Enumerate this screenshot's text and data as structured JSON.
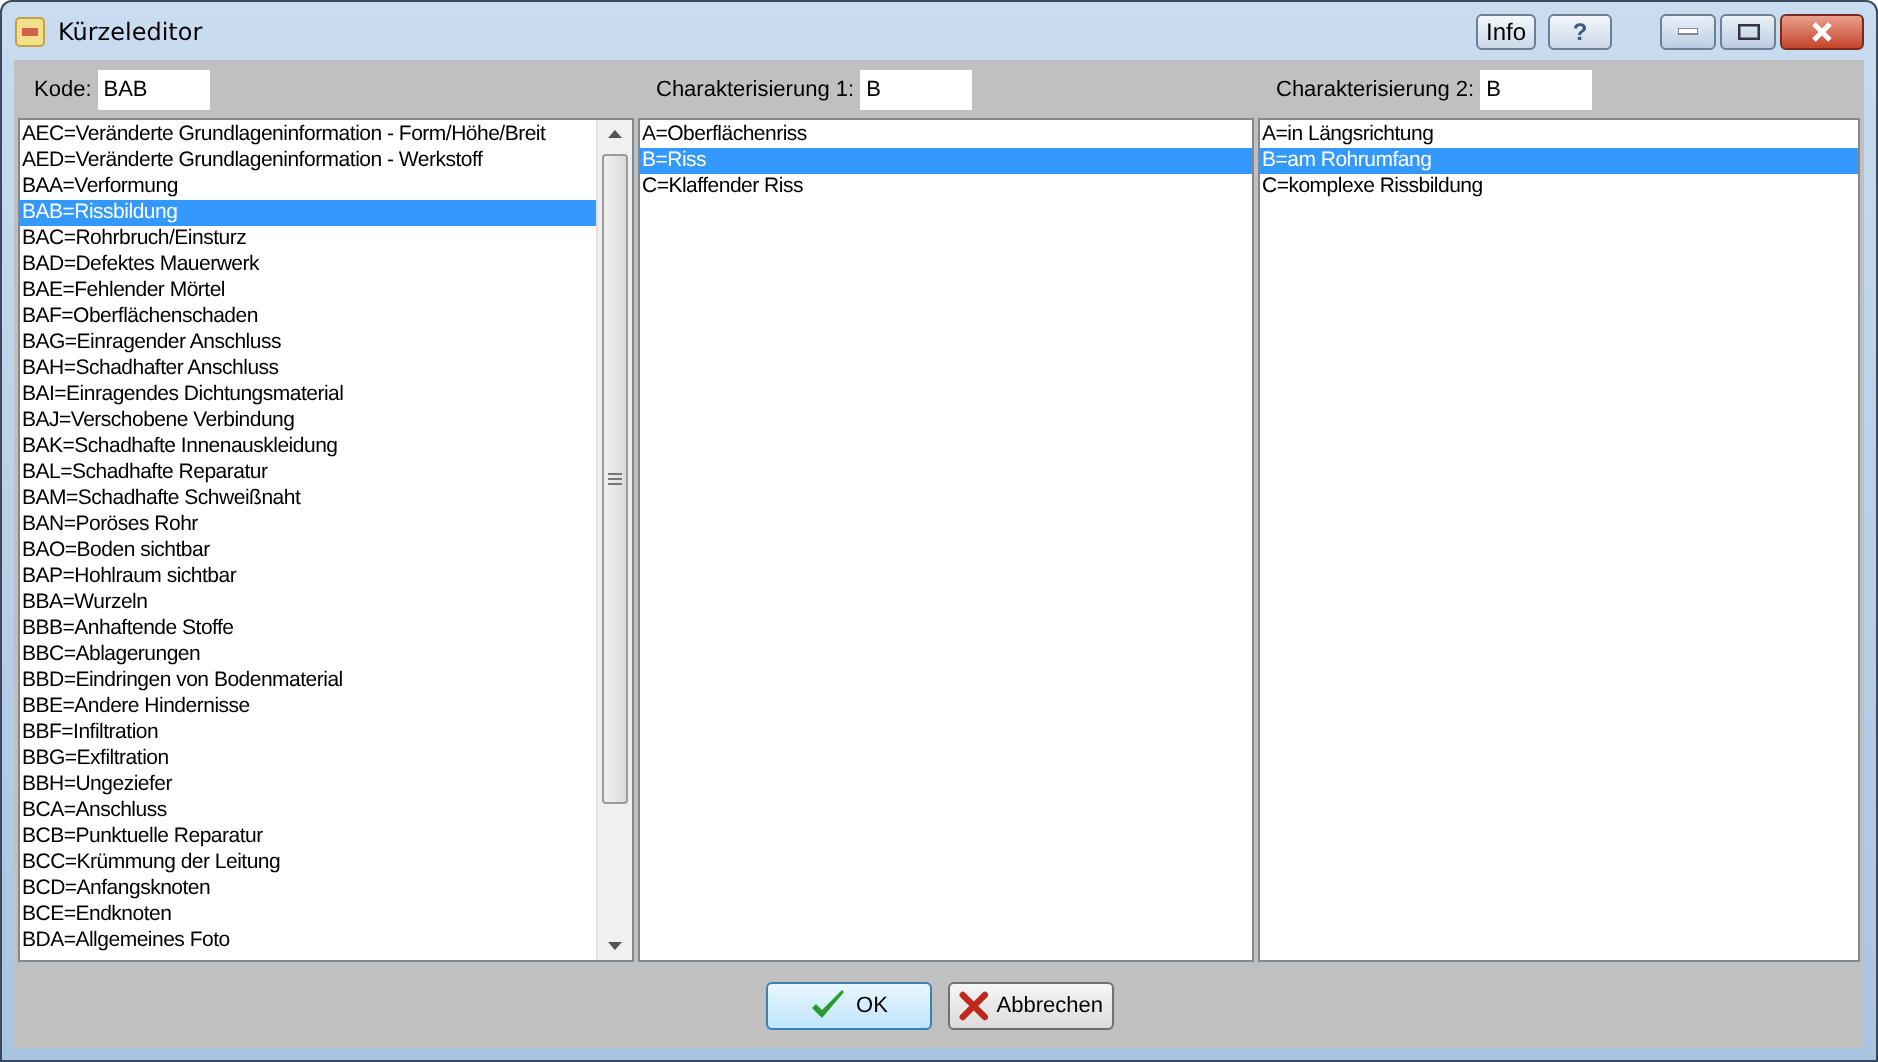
{
  "window": {
    "title": "Kürzeleditor",
    "title_buttons": [
      "Info",
      "?"
    ]
  },
  "columns": [
    {
      "label": "Kode:",
      "value": "BAB",
      "scrollable": true,
      "items": [
        {
          "text": "AEC=Veränderte Grundlageninformation - Form/Höhe/Breit",
          "selected": false
        },
        {
          "text": "AED=Veränderte Grundlageninformation - Werkstoff",
          "selected": false
        },
        {
          "text": "BAA=Verformung",
          "selected": false
        },
        {
          "text": "BAB=Rissbildung",
          "selected": true
        },
        {
          "text": "BAC=Rohrbruch/Einsturz",
          "selected": false
        },
        {
          "text": "BAD=Defektes Mauerwerk",
          "selected": false
        },
        {
          "text": "BAE=Fehlender Mörtel",
          "selected": false
        },
        {
          "text": "BAF=Oberflächenschaden",
          "selected": false
        },
        {
          "text": "BAG=Einragender Anschluss",
          "selected": false
        },
        {
          "text": "BAH=Schadhafter Anschluss",
          "selected": false
        },
        {
          "text": "BAI=Einragendes Dichtungsmaterial",
          "selected": false
        },
        {
          "text": "BAJ=Verschobene Verbindung",
          "selected": false
        },
        {
          "text": "BAK=Schadhafte Innenauskleidung",
          "selected": false
        },
        {
          "text": "BAL=Schadhafte Reparatur",
          "selected": false
        },
        {
          "text": "BAM=Schadhafte Schweißnaht",
          "selected": false
        },
        {
          "text": "BAN=Poröses Rohr",
          "selected": false
        },
        {
          "text": "BAO=Boden sichtbar",
          "selected": false
        },
        {
          "text": "BAP=Hohlraum sichtbar",
          "selected": false
        },
        {
          "text": "BBA=Wurzeln",
          "selected": false
        },
        {
          "text": "BBB=Anhaftende Stoffe",
          "selected": false
        },
        {
          "text": "BBC=Ablagerungen",
          "selected": false
        },
        {
          "text": "BBD=Eindringen von Bodenmaterial",
          "selected": false
        },
        {
          "text": "BBE=Andere Hindernisse",
          "selected": false
        },
        {
          "text": "BBF=Infiltration",
          "selected": false
        },
        {
          "text": "BBG=Exfiltration",
          "selected": false
        },
        {
          "text": "BBH=Ungeziefer",
          "selected": false
        },
        {
          "text": "BCA=Anschluss",
          "selected": false
        },
        {
          "text": "BCB=Punktuelle Reparatur",
          "selected": false
        },
        {
          "text": "BCC=Krümmung der Leitung",
          "selected": false
        },
        {
          "text": "BCD=Anfangsknoten",
          "selected": false
        },
        {
          "text": "BCE=Endknoten",
          "selected": false
        },
        {
          "text": "BDA=Allgemeines Foto",
          "selected": false
        }
      ]
    },
    {
      "label": "Charakterisierung 1:",
      "value": "B",
      "scrollable": false,
      "items": [
        {
          "text": "A=Oberflächenriss",
          "selected": false
        },
        {
          "text": "B=Riss",
          "selected": true
        },
        {
          "text": "C=Klaffender Riss",
          "selected": false
        }
      ]
    },
    {
      "label": "Charakterisierung 2:",
      "value": "B",
      "scrollable": false,
      "items": [
        {
          "text": "A=in Längsrichtung",
          "selected": false
        },
        {
          "text": "B=am Rohrumfang",
          "selected": true
        },
        {
          "text": "C=komplexe Rissbildung",
          "selected": false
        }
      ]
    }
  ],
  "buttons": [
    {
      "kind": "ok",
      "label": "OK"
    },
    {
      "kind": "cancel",
      "label": "Abbrechen"
    }
  ]
}
